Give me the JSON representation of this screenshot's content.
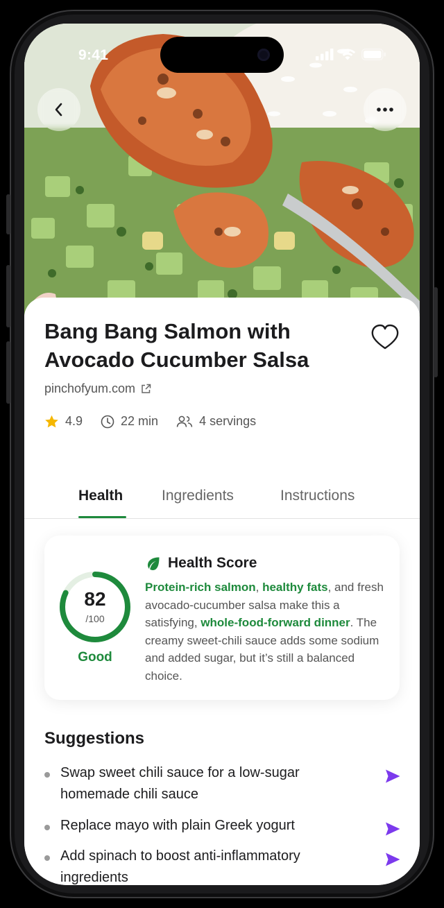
{
  "status_bar": {
    "time": "9:41"
  },
  "hero": {
    "image_alt": "salmon bowl with avocado cucumber salsa"
  },
  "buttons": {
    "back_icon": "chevron-left-icon",
    "more_icon": "more-horizontal-icon"
  },
  "recipe": {
    "title": "Bang Bang Salmon with Avocado Cucumber Salsa",
    "source": "pinchofyum.com",
    "rating": "4.9",
    "time": "22 min",
    "servings": "4 servings"
  },
  "tabs": [
    {
      "label": "Health",
      "active": true
    },
    {
      "label": "Ingredients",
      "active": false
    },
    {
      "label": "Instructions",
      "active": false
    }
  ],
  "health": {
    "title": "Health Score",
    "score": "82",
    "max": "/100",
    "score_value": 82,
    "rating_label": "Good",
    "desc_1": "Protein-rich salmon",
    "desc_2": ", ",
    "desc_3": "healthy fats",
    "desc_4": ", and fresh avocado-cucumber salsa make this a satisfying, ",
    "desc_5": "whole-food-forward dinner",
    "desc_6": ". The creamy sweet-chili sauce adds some sodium and added sugar, but it’s still a balanced choice."
  },
  "suggestions": {
    "title": "Suggestions",
    "items": [
      "Swap sweet chili sauce for a low-sugar homemade chili sauce",
      "Replace mayo with plain Greek yogurt",
      "Add spinach to boost anti-inflammatory ingredients"
    ]
  },
  "colors": {
    "accent_green": "#1e8a3c",
    "send_purple": "#7c3aed"
  }
}
